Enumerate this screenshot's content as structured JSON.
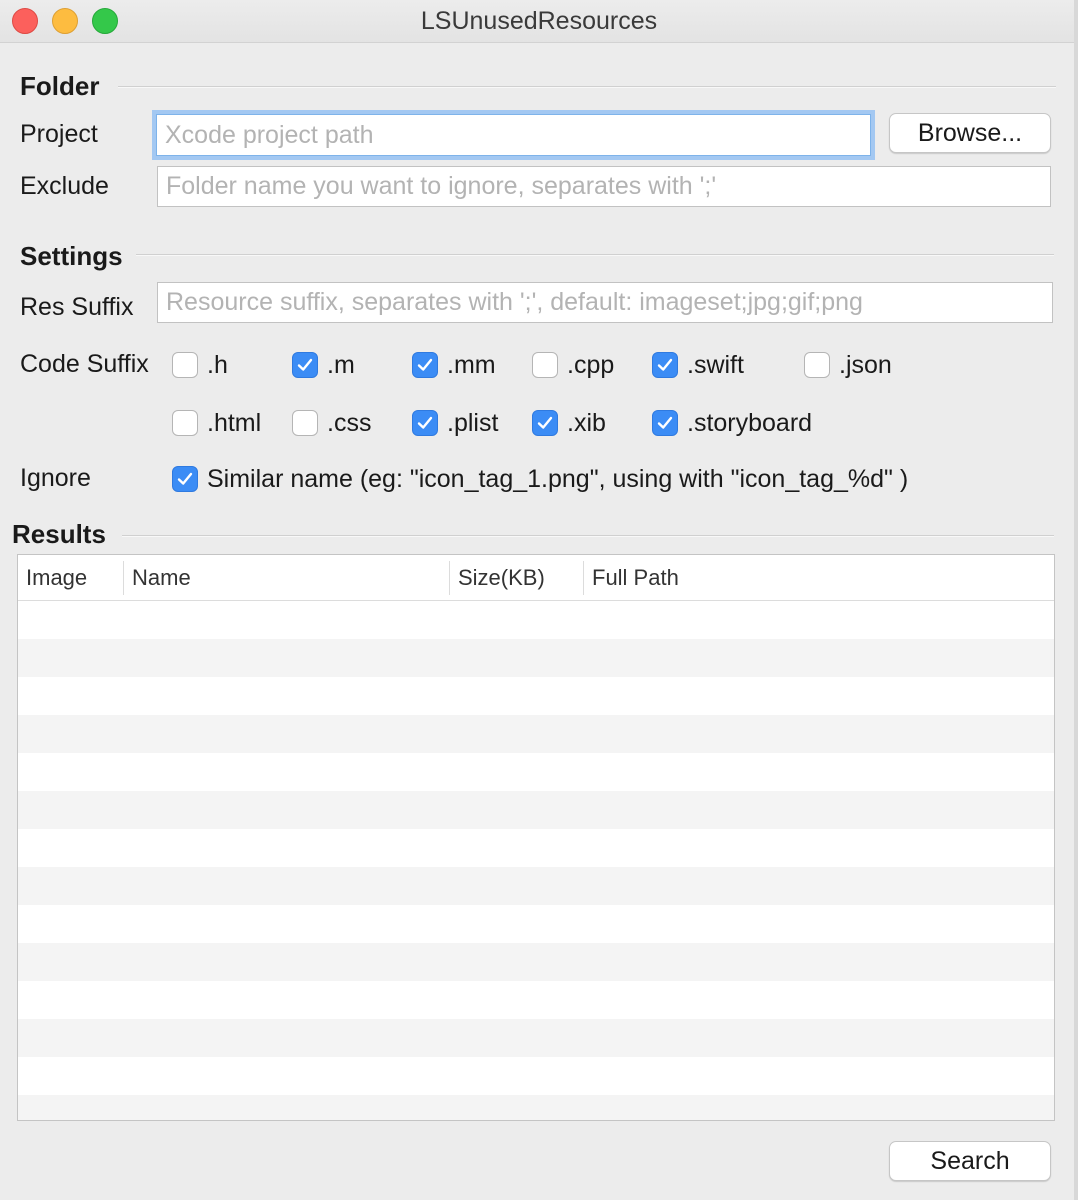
{
  "window": {
    "title": "LSUnusedResources"
  },
  "folder": {
    "heading": "Folder",
    "project_label": "Project",
    "project_placeholder": "Xcode project path",
    "browse_label": "Browse...",
    "exclude_label": "Exclude",
    "exclude_placeholder": "Folder name you want to ignore, separates with ';'"
  },
  "settings": {
    "heading": "Settings",
    "res_suffix_label": "Res Suffix",
    "res_suffix_placeholder": "Resource suffix, separates with ';', default: imageset;jpg;gif;png",
    "code_suffix_label": "Code Suffix",
    "code_suffixes": [
      {
        "label": ".h",
        "checked": false
      },
      {
        "label": ".m",
        "checked": true
      },
      {
        "label": ".mm",
        "checked": true
      },
      {
        "label": ".cpp",
        "checked": false
      },
      {
        "label": ".swift",
        "checked": true
      },
      {
        "label": ".json",
        "checked": false
      },
      {
        "label": ".html",
        "checked": false
      },
      {
        "label": ".css",
        "checked": false
      },
      {
        "label": ".plist",
        "checked": true
      },
      {
        "label": ".xib",
        "checked": true
      },
      {
        "label": ".storyboard",
        "checked": true
      }
    ],
    "ignore_label": "Ignore",
    "ignore_option": {
      "label": "Similar name (eg: \"icon_tag_1.png\", using with \"icon_tag_%d\" )",
      "checked": true
    }
  },
  "results": {
    "heading": "Results",
    "columns": [
      "Image",
      "Name",
      "Size(KB)",
      "Full Path"
    ],
    "rows": []
  },
  "search_label": "Search",
  "colors": {
    "accent": "#3b8cf5",
    "focus_ring": "#a3c8f2"
  }
}
